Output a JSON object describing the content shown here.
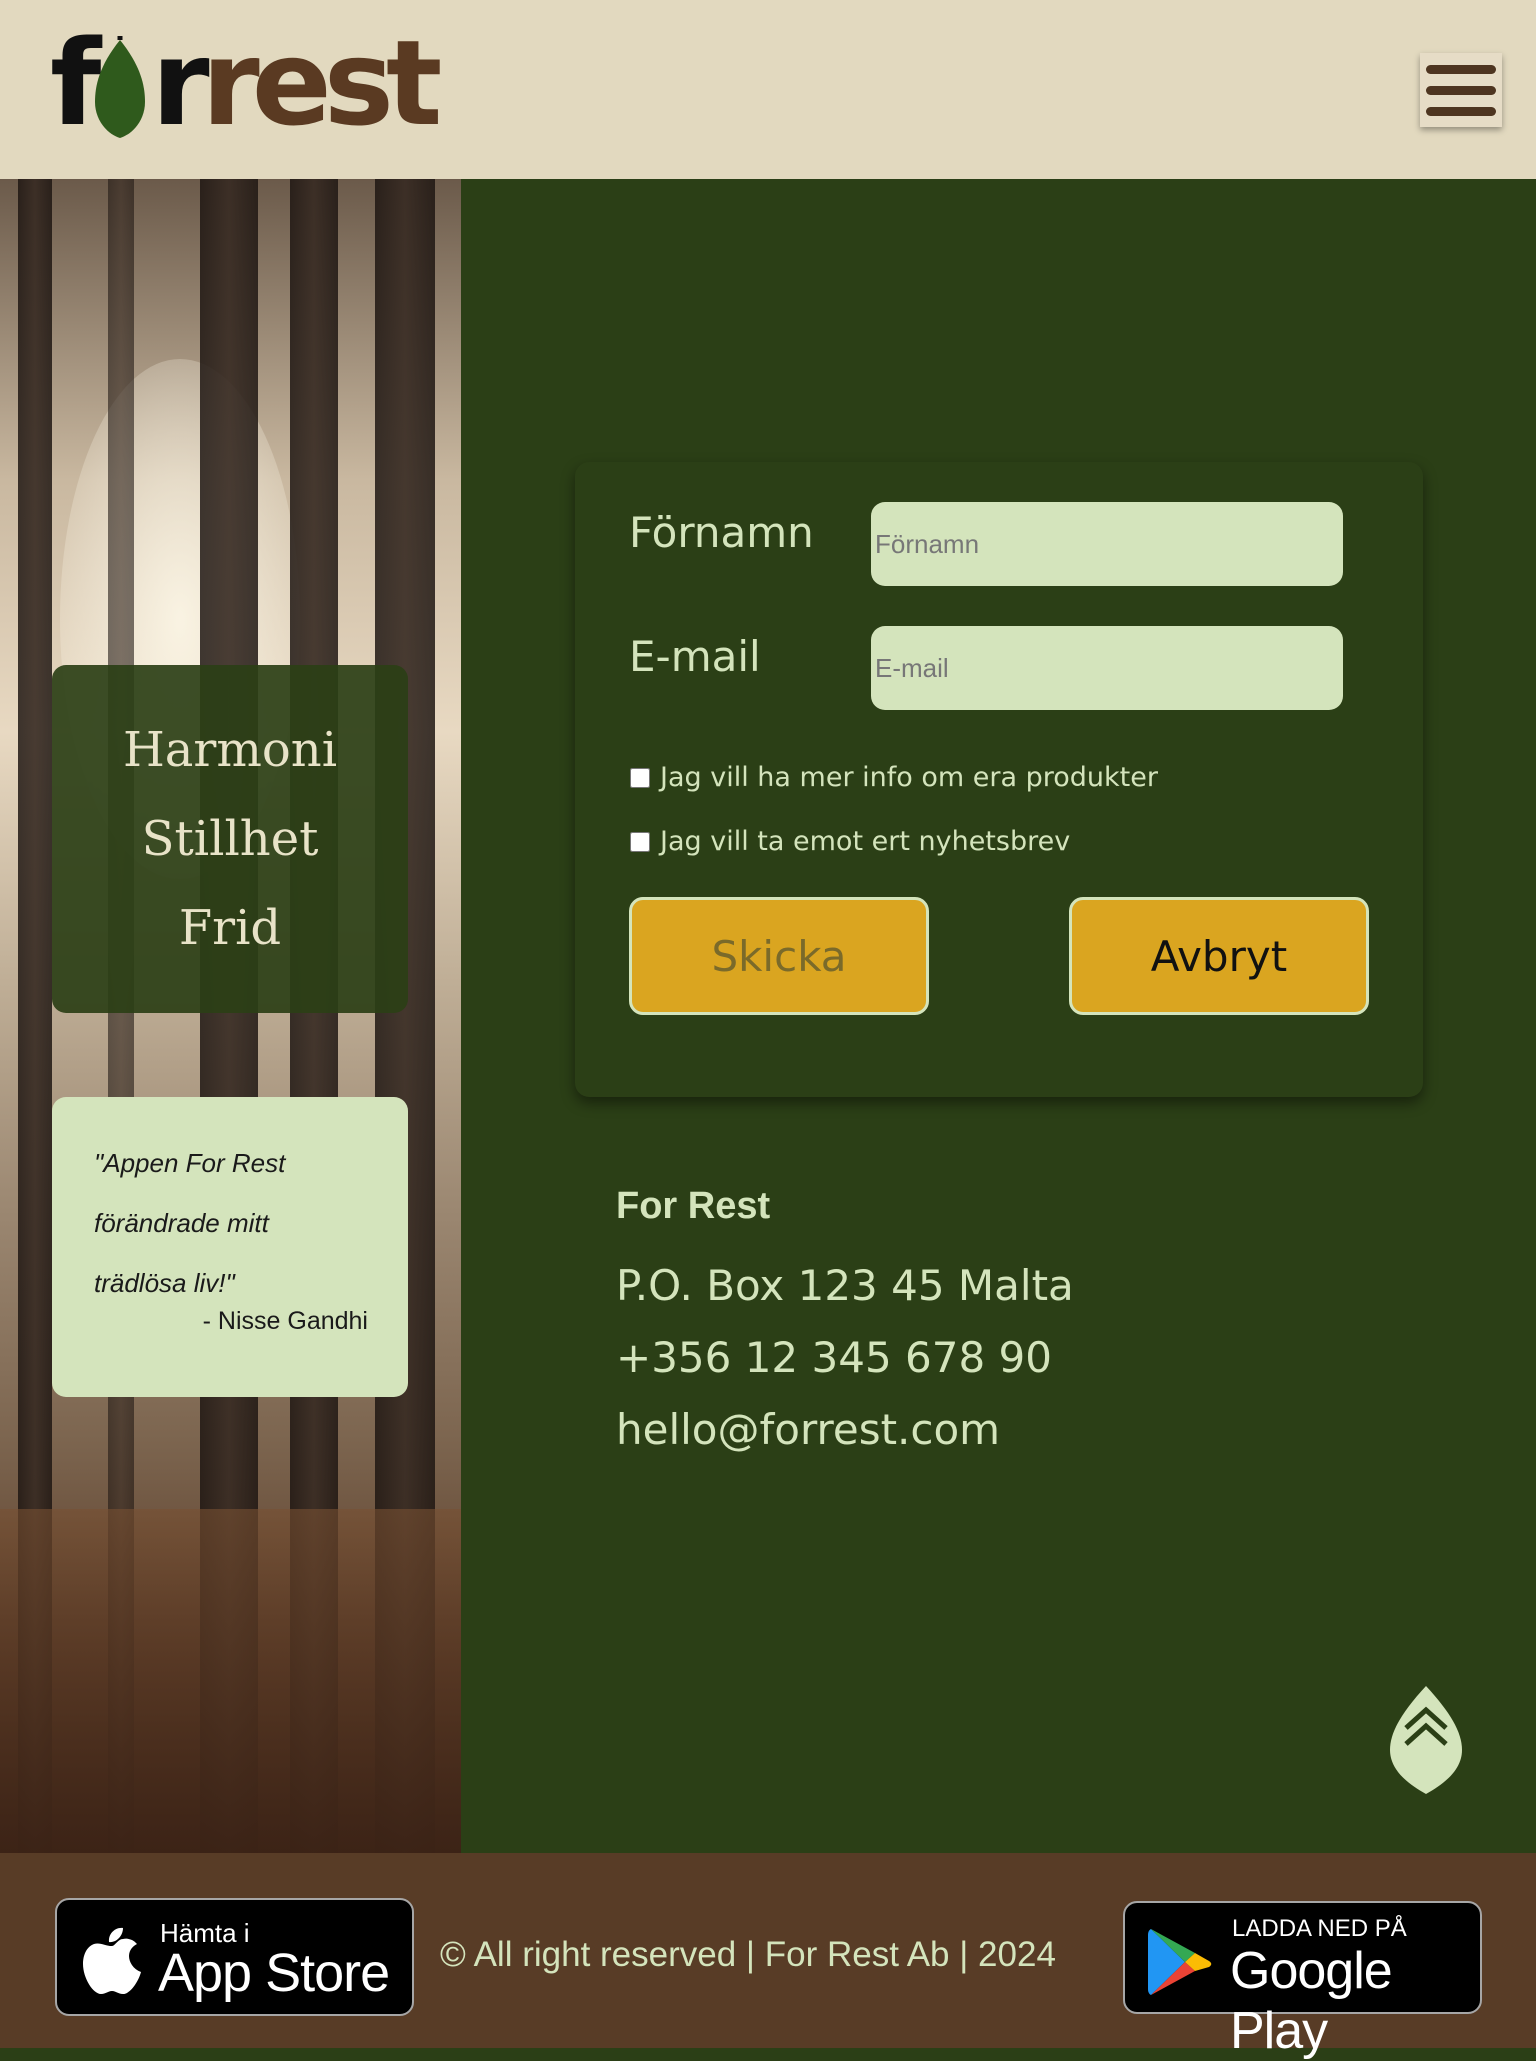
{
  "header": {
    "logo": {
      "part1": "f",
      "part2": "r",
      "part3": "rest"
    },
    "menu_icon": "hamburger-icon"
  },
  "sidebar": {
    "words": [
      "Harmoni",
      "Stillhet",
      "Frid"
    ],
    "quote": {
      "lines": [
        "\"Appen For Rest",
        "förändrade mitt",
        "trädlösa liv!\""
      ],
      "author": "- Nisse Gandhi"
    }
  },
  "form": {
    "firstname": {
      "label": "Förnamn",
      "placeholder": "Förnamn",
      "value": ""
    },
    "email": {
      "label": "E-mail",
      "placeholder": "E-mail",
      "value": ""
    },
    "checkbox_info": {
      "label": "Jag vill ha mer info om era produkter",
      "checked": false
    },
    "checkbox_newsletter": {
      "label": "Jag vill ta emot ert nyhetsbrev",
      "checked": false
    },
    "submit_label": "Skicka",
    "cancel_label": "Avbryt"
  },
  "contact": {
    "name": "For Rest",
    "address": "P.O. Box 123 45 Malta",
    "phone": "+356 12 345 678 90",
    "email": "hello@forrest.com"
  },
  "footer": {
    "appstore": {
      "small": "Hämta i",
      "big": "App Store"
    },
    "copyright": "© All right reserved | For Rest Ab | 2024",
    "googleplay": {
      "small": "LADDA NED PÅ",
      "big": "Google Play"
    }
  },
  "colors": {
    "dark_green": "#2b3f16",
    "light_green": "#d4e4bc",
    "beige": "#e2d9bf",
    "brown": "#583c26",
    "gold": "#daa520"
  }
}
